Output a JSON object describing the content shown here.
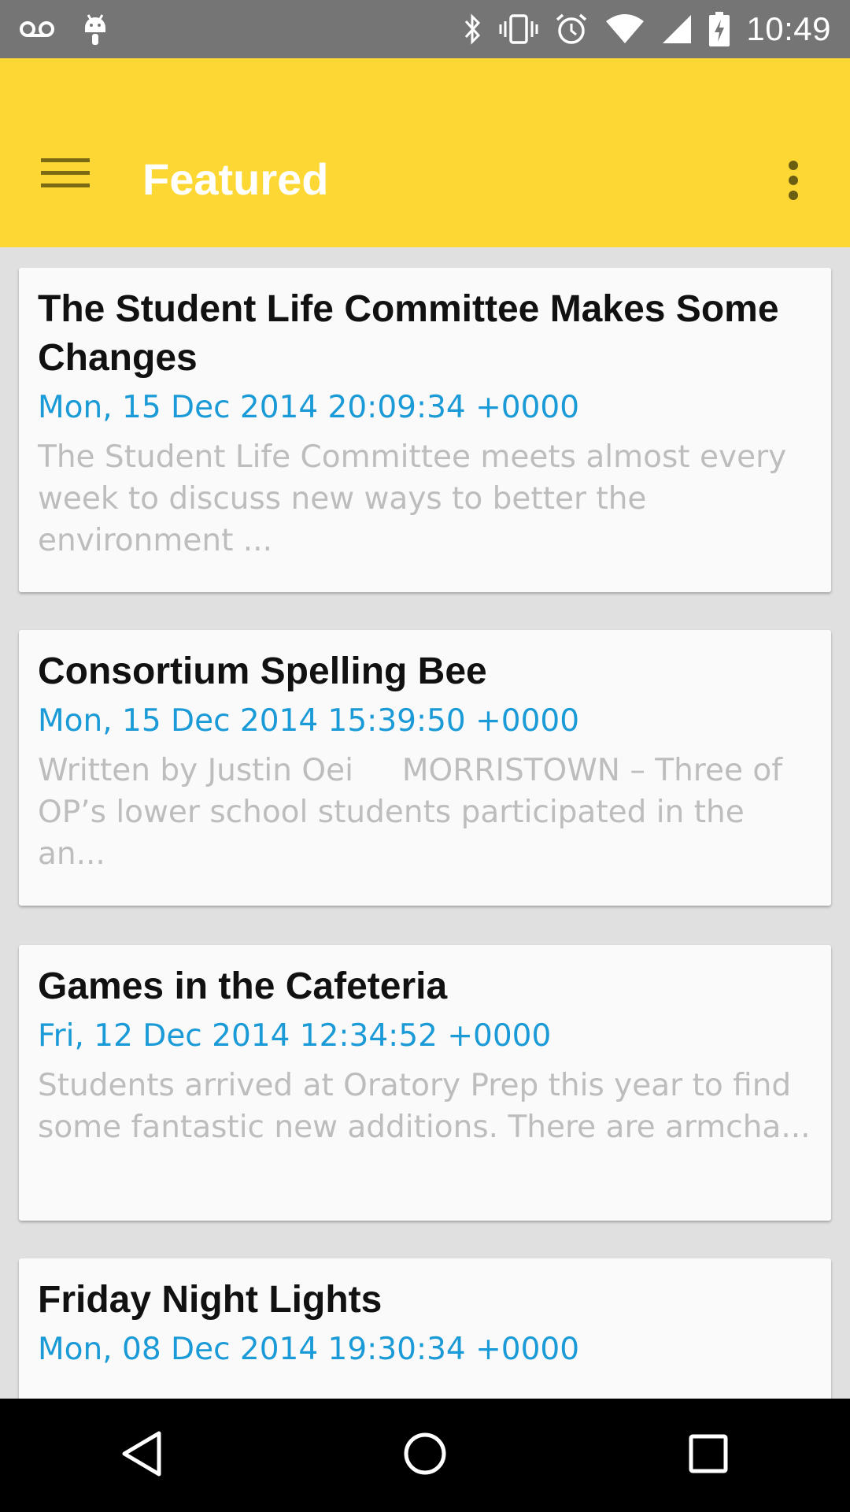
{
  "status_bar": {
    "time": "10:49",
    "icons": [
      "voicemail-icon",
      "android-debug-icon",
      "bluetooth-icon",
      "vibrate-icon",
      "alarm-icon",
      "wifi-icon",
      "signal-icon",
      "battery-charging-icon"
    ]
  },
  "app_bar": {
    "title": "Featured",
    "menu_icon": "hamburger-menu-icon",
    "overflow_icon": "more-vert-icon",
    "color": "#fdd835"
  },
  "articles": [
    {
      "title": "The Student Life Committee Makes Some Changes",
      "date": "Mon, 15 Dec 2014 20:09:34 +0000",
      "excerpt": "The Student Life Committee meets almost every week to discuss new ways to better the environment ..."
    },
    {
      "title": "Consortium Spelling Bee",
      "date": "Mon, 15 Dec 2014 15:39:50 +0000",
      "excerpt": "Written by Justin Oei     MORRISTOWN – Three of OP’s lower school students participated in the an..."
    },
    {
      "title": "Games in the Cafeteria",
      "date": "Fri, 12 Dec 2014 12:34:52 +0000",
      "excerpt": "Students arrived at Oratory Prep this year to find some fantastic new additions. There are armcha..."
    },
    {
      "title": "Friday Night Lights",
      "date": "Mon, 08 Dec 2014 19:30:34 +0000",
      "excerpt": ""
    }
  ],
  "colors": {
    "date": "#1a9ad6",
    "excerpt": "#bdbdbd",
    "status_bar": "#757575",
    "background": "#e0e0e0"
  },
  "nav_bar": {
    "icons": [
      "back-icon",
      "home-icon",
      "recents-icon"
    ]
  }
}
